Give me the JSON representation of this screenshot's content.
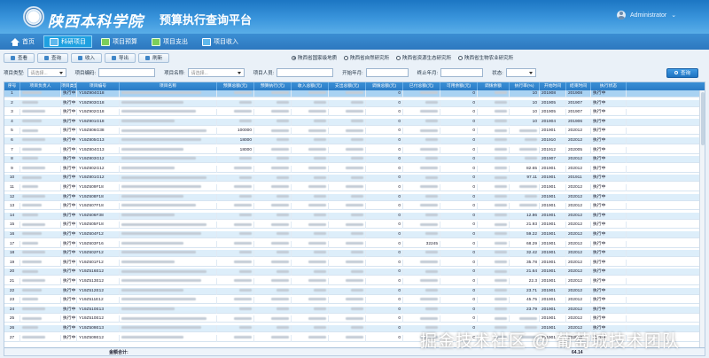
{
  "header": {
    "school": "陕西本科学院",
    "platform": "预算执行查询平台",
    "user": "Administrator"
  },
  "nav": [
    {
      "label": "首页",
      "icon": "home-icon",
      "active": false
    },
    {
      "label": "科研项目",
      "icon": "grid-icon",
      "active": true
    },
    {
      "label": "项目预算",
      "icon": "budget-icon",
      "active": false
    },
    {
      "label": "项目支出",
      "icon": "expense-icon",
      "active": false
    },
    {
      "label": "项目收入",
      "icon": "income-icon",
      "active": false
    }
  ],
  "toolbar": {
    "buttons": [
      "查看",
      "查询",
      "收入",
      "导出",
      "刷新"
    ],
    "radios": [
      "陕西省国家级地质",
      "陕西省自然研究所",
      "陕西省资源生态研究所",
      "陕西省生物农业研究所"
    ],
    "radio_selected": 0
  },
  "filters": {
    "type_label": "项目类型:",
    "code_label": "项目编码:",
    "name_label": "项目名称:",
    "person_label": "项目人员:",
    "start_label": "开始年月:",
    "end_label": "终止年月:",
    "status_label": "状态:",
    "placeholder": "请选择...",
    "query": "查询"
  },
  "columns": [
    "序号",
    "项目负责人",
    "项目类型",
    "项目编号",
    "项目名称",
    "预算总额(元)",
    "预算执行(元)",
    "收入总额(元)",
    "支出总额(元)",
    "调拨总额(元)",
    "已付总额(元)",
    "可用余额(元)",
    "调拨余额",
    "执行率(%)",
    "开始时间",
    "结束时间",
    "执行状态"
  ],
  "rows": [
    {
      "no": "1",
      "type": "执行中",
      "code": "Y19Z904G18",
      "budget": "",
      "exec": "",
      "income": "",
      "expense": "",
      "transfer": "0",
      "paid": "",
      "avail": "0",
      "rate": "10",
      "start": "201908",
      "end": "201908",
      "status": "执行中"
    },
    {
      "no": "2",
      "type": "执行中",
      "code": "Y19Z903G18",
      "budget": "",
      "exec": "",
      "income": "",
      "expense": "",
      "transfer": "0",
      "paid": "",
      "avail": "0",
      "rate": "10",
      "start": "201905",
      "end": "201907",
      "status": "执行中"
    },
    {
      "no": "3",
      "type": "执行中",
      "code": "Y19Z902G18",
      "budget": "",
      "exec": "",
      "income": "",
      "expense": "",
      "transfer": "0",
      "paid": "",
      "avail": "0",
      "rate": "10",
      "start": "201905",
      "end": "201907",
      "status": "执行中"
    },
    {
      "no": "4",
      "type": "执行中",
      "code": "Y19Z901G18",
      "budget": "",
      "exec": "",
      "income": "",
      "expense": "",
      "transfer": "0",
      "paid": "",
      "avail": "0",
      "rate": "10",
      "start": "201904",
      "end": "201906",
      "status": "执行中"
    },
    {
      "no": "5",
      "type": "执行中",
      "code": "Y19Z806G38",
      "budget": "100000",
      "exec": "",
      "income": "",
      "expense": "",
      "transfer": "0",
      "paid": "",
      "avail": "0",
      "rate": "",
      "start": "201901",
      "end": "202012",
      "status": "执行中"
    },
    {
      "no": "6",
      "type": "执行中",
      "code": "Y19Z805G13",
      "budget": "18000",
      "exec": "",
      "income": "",
      "expense": "",
      "transfer": "0",
      "paid": "",
      "avail": "0",
      "rate": "",
      "start": "201910",
      "end": "202012",
      "status": "执行中"
    },
    {
      "no": "7",
      "type": "执行中",
      "code": "Y19Z804G13",
      "budget": "18000",
      "exec": "",
      "income": "",
      "expense": "",
      "transfer": "0",
      "paid": "",
      "avail": "0",
      "rate": "",
      "start": "201912",
      "end": "202005",
      "status": "执行中"
    },
    {
      "no": "8",
      "type": "执行中",
      "code": "Y19Z803G12",
      "budget": "",
      "exec": "",
      "income": "",
      "expense": "",
      "transfer": "0",
      "paid": "",
      "avail": "0",
      "rate": "",
      "start": "201907",
      "end": "202012",
      "status": "执行中"
    },
    {
      "no": "9",
      "type": "执行中",
      "code": "Y19Z802G12",
      "budget": "",
      "exec": "",
      "income": "",
      "expense": "",
      "transfer": "0",
      "paid": "",
      "avail": "0",
      "rate": "82.65",
      "start": "201901",
      "end": "202012",
      "status": "执行中"
    },
    {
      "no": "10",
      "type": "执行中",
      "code": "Y19Z801G12",
      "budget": "",
      "exec": "",
      "income": "",
      "expense": "",
      "transfer": "0",
      "paid": "",
      "avail": "0",
      "rate": "97.11",
      "start": "201901",
      "end": "201911",
      "status": "执行中"
    },
    {
      "no": "11",
      "type": "执行中",
      "code": "Y19Z609F18",
      "budget": "",
      "exec": "",
      "income": "",
      "expense": "",
      "transfer": "0",
      "paid": "",
      "avail": "0",
      "rate": "",
      "start": "201901",
      "end": "202012",
      "status": "执行中"
    },
    {
      "no": "12",
      "type": "执行中",
      "code": "Y19Z608F18",
      "budget": "",
      "exec": "",
      "income": "",
      "expense": "",
      "transfer": "0",
      "paid": "",
      "avail": "0",
      "rate": "",
      "start": "201901",
      "end": "202012",
      "status": "执行中"
    },
    {
      "no": "13",
      "type": "执行中",
      "code": "Y19Z607F18",
      "budget": "",
      "exec": "",
      "income": "",
      "expense": "",
      "transfer": "0",
      "paid": "",
      "avail": "0",
      "rate": "",
      "start": "201901",
      "end": "202012",
      "status": "执行中"
    },
    {
      "no": "14",
      "type": "执行中",
      "code": "Y19Z606F38",
      "budget": "",
      "exec": "",
      "income": "",
      "expense": "",
      "transfer": "0",
      "paid": "",
      "avail": "0",
      "rate": "12.86",
      "start": "201901",
      "end": "202012",
      "status": "执行中"
    },
    {
      "no": "15",
      "type": "执行中",
      "code": "Y19Z605F18",
      "budget": "",
      "exec": "",
      "income": "",
      "expense": "",
      "transfer": "0",
      "paid": "",
      "avail": "0",
      "rate": "21.93",
      "start": "201901",
      "end": "202012",
      "status": "执行中"
    },
    {
      "no": "16",
      "type": "执行中",
      "code": "Y19Z604F12",
      "budget": "",
      "exec": "",
      "income": "",
      "expense": "",
      "transfer": "0",
      "paid": "",
      "avail": "0",
      "rate": "59.22",
      "start": "201901",
      "end": "202012",
      "status": "执行中"
    },
    {
      "no": "17",
      "type": "执行中",
      "code": "Y19Z603F16",
      "budget": "",
      "exec": "",
      "income": "",
      "expense": "",
      "transfer": "0",
      "paid": "32245",
      "avail": "0",
      "rate": "68.29",
      "start": "201901",
      "end": "202012",
      "status": "执行中"
    },
    {
      "no": "18",
      "type": "执行中",
      "code": "Y19Z602F12",
      "budget": "",
      "exec": "",
      "income": "",
      "expense": "",
      "transfer": "0",
      "paid": "",
      "avail": "0",
      "rate": "32.42",
      "start": "201901",
      "end": "202012",
      "status": "执行中"
    },
    {
      "no": "19",
      "type": "执行中",
      "code": "Y19Z601F12",
      "budget": "",
      "exec": "",
      "income": "",
      "expense": "",
      "transfer": "0",
      "paid": "",
      "avail": "0",
      "rate": "35.78",
      "start": "201901",
      "end": "202012",
      "status": "执行中"
    },
    {
      "no": "20",
      "type": "执行中",
      "code": "Y19Z516E12",
      "budget": "",
      "exec": "",
      "income": "",
      "expense": "",
      "transfer": "0",
      "paid": "",
      "avail": "0",
      "rate": "21.64",
      "start": "201901",
      "end": "202012",
      "status": "执行中"
    },
    {
      "no": "21",
      "type": "执行中",
      "code": "Y19Z513E12",
      "budget": "",
      "exec": "",
      "income": "",
      "expense": "",
      "transfer": "0",
      "paid": "",
      "avail": "0",
      "rate": "22.3",
      "start": "201901",
      "end": "202012",
      "status": "执行中"
    },
    {
      "no": "22",
      "type": "执行中",
      "code": "Y19Z512E12",
      "budget": "",
      "exec": "",
      "income": "",
      "expense": "",
      "transfer": "0",
      "paid": "",
      "avail": "0",
      "rate": "23.71",
      "start": "201901",
      "end": "202012",
      "status": "执行中"
    },
    {
      "no": "23",
      "type": "执行中",
      "code": "Y19Z511E12",
      "budget": "",
      "exec": "",
      "income": "",
      "expense": "",
      "transfer": "0",
      "paid": "",
      "avail": "0",
      "rate": "45.75",
      "start": "201901",
      "end": "202012",
      "status": "执行中"
    },
    {
      "no": "24",
      "type": "执行中",
      "code": "Y19Z510E13",
      "budget": "",
      "exec": "",
      "income": "",
      "expense": "",
      "transfer": "0",
      "paid": "",
      "avail": "0",
      "rate": "23.79",
      "start": "201901",
      "end": "202012",
      "status": "执行中"
    },
    {
      "no": "25",
      "type": "执行中",
      "code": "Y19Z510E12",
      "budget": "",
      "exec": "",
      "income": "",
      "expense": "",
      "transfer": "0",
      "paid": "",
      "avail": "0",
      "rate": "",
      "start": "201901",
      "end": "202012",
      "status": "执行中"
    },
    {
      "no": "26",
      "type": "执行中",
      "code": "Y19Z509E13",
      "budget": "",
      "exec": "",
      "income": "",
      "expense": "",
      "transfer": "0",
      "paid": "",
      "avail": "0",
      "rate": "",
      "start": "201901",
      "end": "202012",
      "status": "执行中"
    },
    {
      "no": "27",
      "type": "执行中",
      "code": "Y19Z509E12",
      "budget": "",
      "exec": "",
      "income": "",
      "expense": "",
      "transfer": "0",
      "paid": "",
      "avail": "0",
      "rate": "",
      "start": "201901",
      "end": "202012",
      "status": "执行中"
    }
  ],
  "total": {
    "label": "金额合计:",
    "rate": "64.14"
  },
  "watermark": "掘金技术社区 @ 葡萄城技术团队"
}
